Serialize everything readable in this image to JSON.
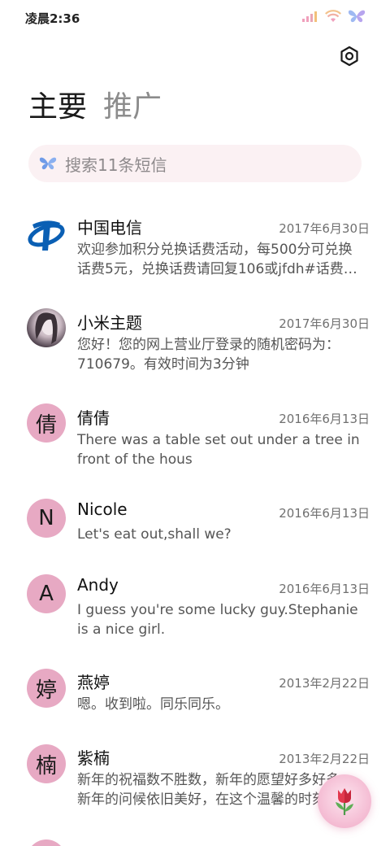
{
  "status_bar": {
    "time": "凌晨2:36",
    "icons": [
      "signal-icon",
      "wifi-icon",
      "butterfly-icon"
    ]
  },
  "header": {
    "settings_icon": "settings-icon"
  },
  "tabs": [
    {
      "label": "主要",
      "active": true
    },
    {
      "label": "推广",
      "active": false
    }
  ],
  "search": {
    "placeholder": "搜索11条短信",
    "icon": "butterfly-icon"
  },
  "colors": {
    "avatar_bg": "#e7a9c3",
    "search_bg": "#fbf1f3",
    "telecom_blue": "#0a5fb4"
  },
  "conversations": [
    {
      "avatar_type": "logo",
      "avatar_text": "",
      "name": "中国电信",
      "date": "2017年6月30日",
      "preview": "欢迎参加积分兑换话费活动，每500分可兑换话费5元，兑换话费请回复106或jfdh#话费…"
    },
    {
      "avatar_type": "photo",
      "avatar_text": "",
      "name": "小米主题",
      "date": "2017年6月30日",
      "preview": "您好！您的网上营业厅登录的随机密码为：710679。有效时间为3分钟"
    },
    {
      "avatar_type": "letter",
      "avatar_text": "倩",
      "name": "倩倩",
      "date": "2016年6月13日",
      "preview": "There was a table set out under a tree in front of the hous"
    },
    {
      "avatar_type": "letter",
      "avatar_text": "N",
      "name": "Nicole",
      "date": "2016年6月13日",
      "preview": "Let's eat out,shall we?"
    },
    {
      "avatar_type": "letter",
      "avatar_text": "A",
      "name": "Andy",
      "date": "2016年6月13日",
      "preview": "I guess you're some lucky guy.Stephanie is a nice girl."
    },
    {
      "avatar_type": "letter",
      "avatar_text": "婷",
      "name": "燕婷",
      "date": "2013年2月22日",
      "preview": "嗯。收到啦。同乐同乐。"
    },
    {
      "avatar_type": "letter",
      "avatar_text": "楠",
      "name": "紫楠",
      "date": "2013年2月22日",
      "preview": "新年的祝福数不胜数，新年的愿望好多好多，新年的问候依旧美好，在这个温馨的时刻"
    }
  ],
  "fab": {
    "icon": "tulip-icon"
  }
}
